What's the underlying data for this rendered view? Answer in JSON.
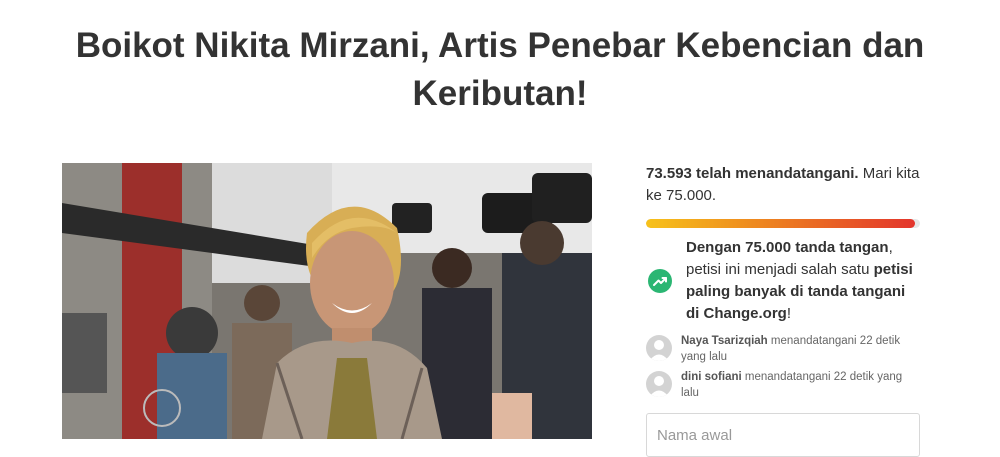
{
  "petition": {
    "title": "Boikot Nikita Mirzani, Artis Penebar Kebencian dan Keributan!"
  },
  "signatures": {
    "count_text": "73.593 telah menandatangani.",
    "goal_text": "Mari kita ke 75.000.",
    "progress": 0.981
  },
  "milestone": {
    "strong_1": "Dengan 75.000 tanda tangan",
    "text_1": ", petisi ini menjadi salah satu ",
    "strong_2": "petisi paling banyak di tanda tangani di Change.org",
    "text_2": "!",
    "icon": "trending-up-icon"
  },
  "recent_signers": [
    {
      "name": "Naya Tsarizqiah",
      "action": "menandatangani 22 detik yang lalu"
    },
    {
      "name": "dini sofiani",
      "action": "menandatangani 22 detik yang lalu"
    }
  ],
  "form": {
    "first_name_placeholder": "Nama awal"
  },
  "colors": {
    "progress_start": "#f7c21b",
    "progress_end": "#e3352c",
    "milestone_icon": "#2bb673"
  }
}
